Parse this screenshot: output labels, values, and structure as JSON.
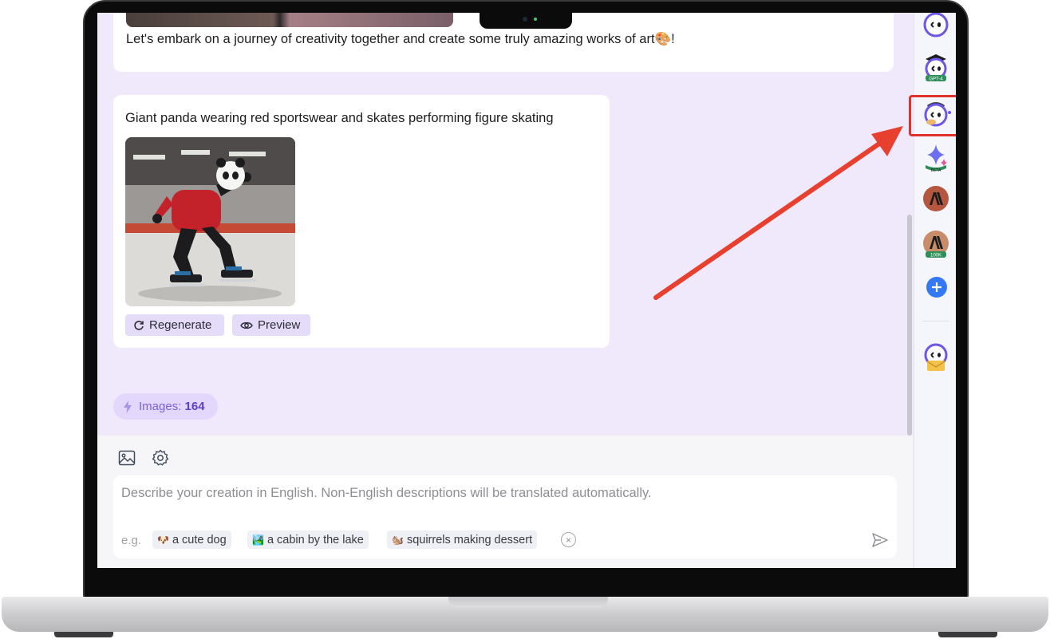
{
  "chat": {
    "previous_message": "Let's embark on a journey of creativity together and create some truly amazing works of art🎨!",
    "prompt_card": {
      "prompt": "Giant panda wearing red sportswear and skates performing figure skating",
      "regenerate_label": "Regenerate",
      "preview_label": "Preview"
    },
    "images_badge": {
      "label": "Images:",
      "count": "164"
    }
  },
  "composer": {
    "placeholder": "Describe your creation in English. Non-English descriptions will be translated automatically.",
    "examples_prefix": "e.g.",
    "examples": [
      {
        "emoji": "🐶",
        "label": "a cute dog"
      },
      {
        "emoji": "🏞️",
        "label": "a cabin by the lake"
      },
      {
        "emoji": "🐿️",
        "label": "squirrels making dessert"
      }
    ]
  },
  "sidebar": {
    "bots": [
      {
        "icon": "monica-bot-icon",
        "badge": ""
      },
      {
        "icon": "gpt4-bot-icon",
        "badge": "GPT-4"
      },
      {
        "icon": "artist-bot-icon",
        "badge": "",
        "selected": true
      },
      {
        "icon": "gemini-bot-icon",
        "badge": "BETA"
      },
      {
        "icon": "claude-bot-icon",
        "badge": ""
      },
      {
        "icon": "claude-100k-bot-icon",
        "badge": "100K"
      },
      {
        "icon": "add-bot-icon",
        "badge": ""
      },
      {
        "icon": "mail-bot-icon",
        "badge": ""
      }
    ]
  },
  "colors": {
    "background": "#efe9fb",
    "accent": "#7a62d6",
    "button_bg": "#e5dcfa",
    "highlight_border": "#e0312a",
    "arrow": "#e8402f"
  }
}
